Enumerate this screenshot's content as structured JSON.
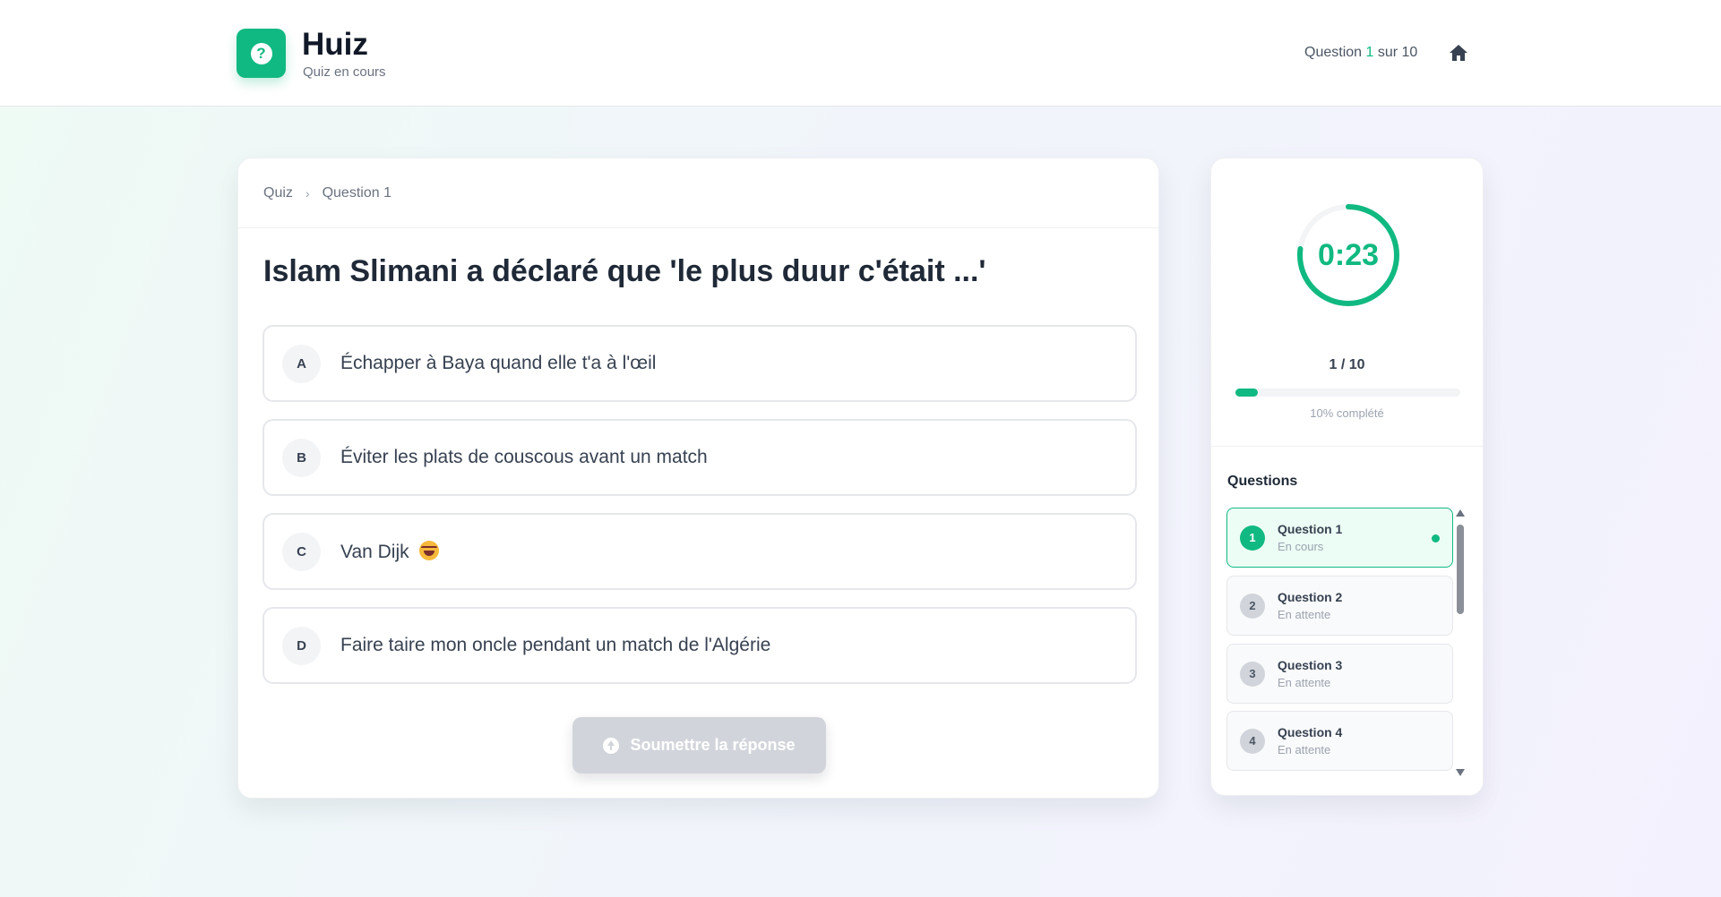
{
  "header": {
    "app_name": "Huiz",
    "subtitle": "Quiz en cours",
    "counter_prefix": "Question",
    "counter_current": "1",
    "counter_suffix": "sur 10",
    "logo_glyph": "?",
    "icons": {
      "logo": "question-circle-icon",
      "home": "home-icon"
    }
  },
  "breadcrumb": {
    "root": "Quiz",
    "current": "Question 1"
  },
  "question": {
    "title": "Islam Slimani a déclaré que 'le plus duur c'était ...'",
    "options": [
      {
        "letter": "A",
        "text": "Échapper à Baya quand elle t'a à l'œil"
      },
      {
        "letter": "B",
        "text": "Éviter les plats de couscous avant un match"
      },
      {
        "letter": "C",
        "text": "Van Dijk",
        "emoji": "laughing-tilted-face-emoji"
      },
      {
        "letter": "D",
        "text": "Faire taire mon oncle pendant un match de l'Algérie"
      }
    ],
    "submit_label": "Soumettre la réponse"
  },
  "sidebar": {
    "timer": "0:23",
    "timer_fraction": 0.77,
    "progress_count": "1 / 10",
    "progress_fraction": 0.1,
    "progress_label": "10% complété",
    "questions_heading": "Questions",
    "items": [
      {
        "num": "1",
        "name": "Question 1",
        "status": "En cours",
        "active": true
      },
      {
        "num": "2",
        "name": "Question 2",
        "status": "En attente",
        "active": false
      },
      {
        "num": "3",
        "name": "Question 3",
        "status": "En attente",
        "active": false
      },
      {
        "num": "4",
        "name": "Question 4",
        "status": "En attente",
        "active": false
      }
    ]
  },
  "colors": {
    "accent": "#10b981",
    "disabled_button": "#d1d5db",
    "text_dark": "#1f2937"
  }
}
